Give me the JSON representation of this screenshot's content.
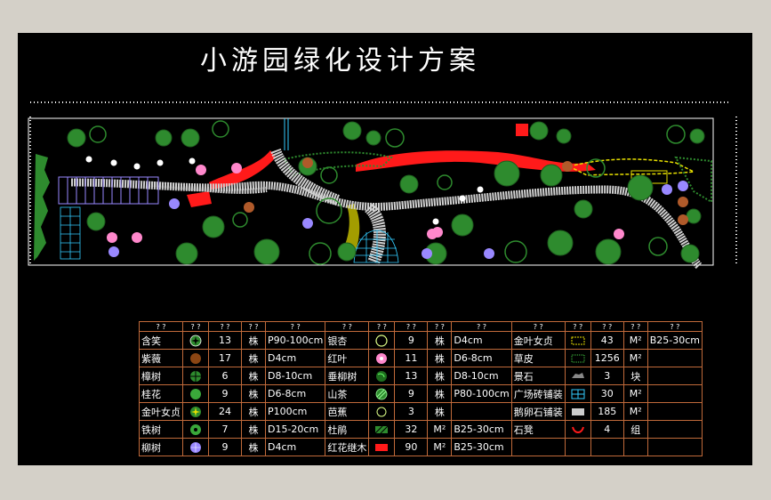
{
  "title": "小游园绿化设计方案",
  "colors": {
    "frame": "#d4d0c8",
    "canvas": "#000000",
    "grid": "#c06a3a",
    "tree": "#2e8b2e",
    "road": "#d0d0d0",
    "red": "#ff1a1a",
    "yellow": "#e8e000",
    "cyan": "#33ccff",
    "purple": "#9988ff"
  },
  "legend": {
    "header": [
      "? ?",
      "? ?",
      "? ?",
      "? ?",
      "? ?",
      "? ?",
      "? ?",
      "? ?",
      "? ?",
      "? ?",
      "? ?",
      "? ?",
      "? ?",
      "? ?",
      "? ?"
    ],
    "rows": [
      [
        {
          "name": "含笑",
          "icon": "star-ring-icon",
          "qty": "13",
          "unit": "株",
          "spec": "P90-100cm"
        },
        {
          "name": "银杏",
          "icon": "ring-icon",
          "qty": "9",
          "unit": "株",
          "spec": "D4cm"
        },
        {
          "name": "金叶女贞",
          "icon": "hatch-yellow-icon",
          "qty": "43",
          "unit": "M²",
          "spec": "B25-30cm"
        }
      ],
      [
        {
          "name": "紫薇",
          "icon": "brown-dot-icon",
          "qty": "17",
          "unit": "株",
          "spec": "D4cm"
        },
        {
          "name": "红叶",
          "icon": "pink-flower-icon",
          "qty": "11",
          "unit": "株",
          "spec": "D6-8cm"
        },
        {
          "name": "草皮",
          "icon": "grass-icon",
          "qty": "1256",
          "unit": "M²",
          "spec": ""
        }
      ],
      [
        {
          "name": "樟树",
          "icon": "cross-tree-icon",
          "qty": "6",
          "unit": "株",
          "spec": "D8-10cm"
        },
        {
          "name": "垂柳树",
          "icon": "swirl-tree-icon",
          "qty": "13",
          "unit": "株",
          "spec": "D8-10cm"
        },
        {
          "name": "景石",
          "icon": "rock-icon",
          "qty": "3",
          "unit": "块",
          "spec": ""
        }
      ],
      [
        {
          "name": "桂花",
          "icon": "green-dot-icon",
          "qty": "9",
          "unit": "株",
          "spec": "D6-8cm"
        },
        {
          "name": "山茶",
          "icon": "hatched-ball-icon",
          "qty": "9",
          "unit": "株",
          "spec": "P80-100cm"
        },
        {
          "name": "广场砖铺装",
          "icon": "cyan-grid-icon",
          "qty": "30",
          "unit": "M²",
          "spec": ""
        }
      ],
      [
        {
          "name": "金叶女贞",
          "icon": "yellow-star-icon",
          "qty": "24",
          "unit": "株",
          "spec": "P100cm"
        },
        {
          "name": "芭蕉",
          "icon": "small-ring-icon",
          "qty": "3",
          "unit": "株",
          "spec": ""
        },
        {
          "name": "鹅卵石铺装",
          "icon": "pebble-icon",
          "qty": "185",
          "unit": "M²",
          "spec": ""
        }
      ],
      [
        {
          "name": "铁树",
          "icon": "palm-icon",
          "qty": "7",
          "unit": "株",
          "spec": "D15-20cm"
        },
        {
          "name": "杜鹃",
          "icon": "green-hatch-icon",
          "qty": "32",
          "unit": "M²",
          "spec": "B25-30cm"
        },
        {
          "name": "石凳",
          "icon": "red-arc-icon",
          "qty": "4",
          "unit": "组",
          "spec": ""
        }
      ],
      [
        {
          "name": "柳树",
          "icon": "purple-flower-icon",
          "qty": "9",
          "unit": "株",
          "spec": "D4cm"
        },
        {
          "name": "红花继木",
          "icon": "red-block-icon",
          "qty": "90",
          "unit": "M²",
          "spec": "B25-30cm"
        },
        {
          "name": "",
          "icon": "",
          "qty": "",
          "unit": "",
          "spec": ""
        }
      ]
    ]
  }
}
